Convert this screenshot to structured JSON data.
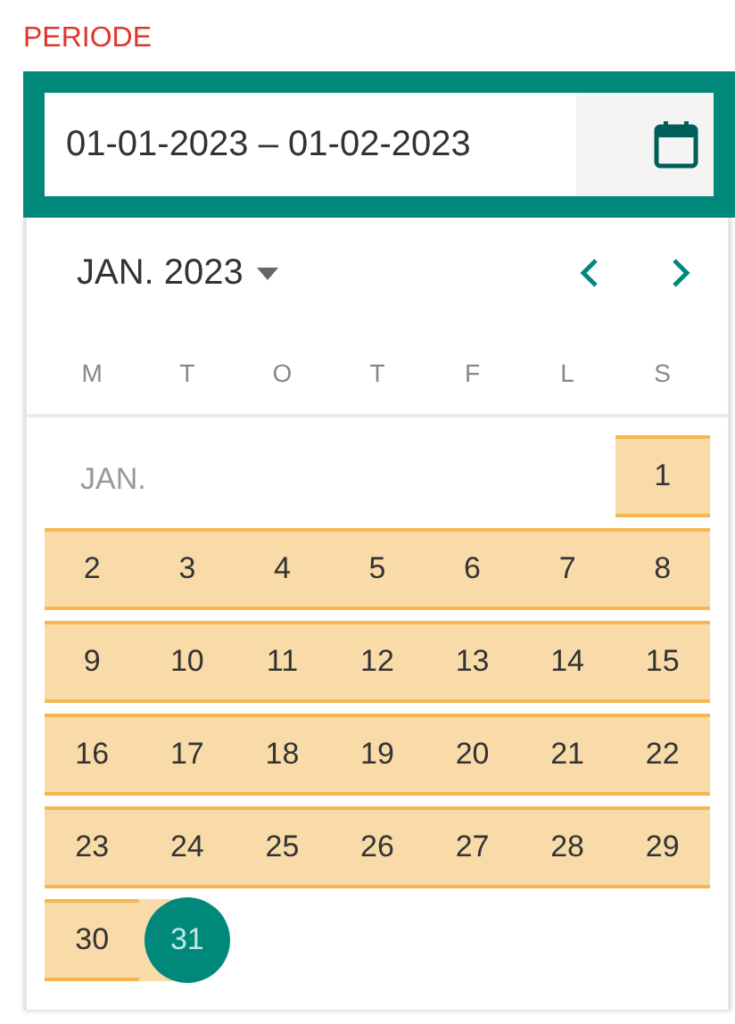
{
  "label": "PERIODE",
  "date_range_field": {
    "value": "01-01-2023 – 01-02-2023",
    "focused": true
  },
  "calendar": {
    "month_year": "JAN. 2023",
    "weekdays": [
      "M",
      "T",
      "O",
      "T",
      "F",
      "L",
      "S"
    ],
    "weeks": [
      {
        "month_label": "JAN.",
        "days": [
          {
            "label": "1",
            "in_range": true,
            "selected": false
          }
        ]
      },
      {
        "days": [
          {
            "label": "2",
            "in_range": true,
            "selected": false
          },
          {
            "label": "3",
            "in_range": true,
            "selected": false
          },
          {
            "label": "4",
            "in_range": true,
            "selected": false
          },
          {
            "label": "5",
            "in_range": true,
            "selected": false
          },
          {
            "label": "6",
            "in_range": true,
            "selected": false
          },
          {
            "label": "7",
            "in_range": true,
            "selected": false
          },
          {
            "label": "8",
            "in_range": true,
            "selected": false
          }
        ]
      },
      {
        "days": [
          {
            "label": "9",
            "in_range": true,
            "selected": false
          },
          {
            "label": "10",
            "in_range": true,
            "selected": false
          },
          {
            "label": "11",
            "in_range": true,
            "selected": false
          },
          {
            "label": "12",
            "in_range": true,
            "selected": false
          },
          {
            "label": "13",
            "in_range": true,
            "selected": false
          },
          {
            "label": "14",
            "in_range": true,
            "selected": false
          },
          {
            "label": "15",
            "in_range": true,
            "selected": false
          }
        ]
      },
      {
        "days": [
          {
            "label": "16",
            "in_range": true,
            "selected": false
          },
          {
            "label": "17",
            "in_range": true,
            "selected": false
          },
          {
            "label": "18",
            "in_range": true,
            "selected": false
          },
          {
            "label": "19",
            "in_range": true,
            "selected": false
          },
          {
            "label": "20",
            "in_range": true,
            "selected": false
          },
          {
            "label": "21",
            "in_range": true,
            "selected": false
          },
          {
            "label": "22",
            "in_range": true,
            "selected": false
          }
        ]
      },
      {
        "days": [
          {
            "label": "23",
            "in_range": true,
            "selected": false
          },
          {
            "label": "24",
            "in_range": true,
            "selected": false
          },
          {
            "label": "25",
            "in_range": true,
            "selected": false
          },
          {
            "label": "26",
            "in_range": true,
            "selected": false
          },
          {
            "label": "27",
            "in_range": true,
            "selected": false
          },
          {
            "label": "28",
            "in_range": true,
            "selected": false
          },
          {
            "label": "29",
            "in_range": true,
            "selected": false
          }
        ]
      },
      {
        "days": [
          {
            "label": "30",
            "in_range": true,
            "selected": false
          },
          {
            "label": "31",
            "in_range": true,
            "selected": true
          }
        ]
      }
    ]
  }
}
